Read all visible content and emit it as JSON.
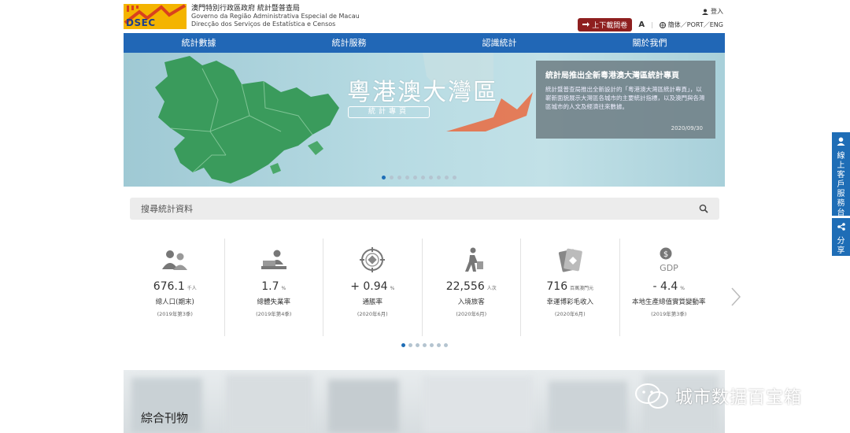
{
  "header": {
    "org_zh": "澳門特別行政區政府 統計暨普查局",
    "org_pt": "Governo da Região Administrativa Especial de Macau",
    "org_pt2": "Direcção dos Serviços de Estatística e Censos",
    "logo_text": "DSEC",
    "login": "登入",
    "download_button": "上下載問卷",
    "font_size": "A",
    "lang": "簡体／PORT／ENG"
  },
  "nav": {
    "items": [
      "統計數據",
      "統計服務",
      "認識統計",
      "關於我們"
    ]
  },
  "banner": {
    "title": "粵港澳大灣區",
    "subtitle": "統計專頁",
    "news_title": "統計局推出全新粵港澳大灣區統計專頁",
    "news_body": "統計暨普查局推出全新設計的「粵港澳大灣區統計專頁」，以嶄新面貌展示大灣區各城市的主要統計指標，以及澳門與各灣區城市的人文及經濟往來數據。",
    "news_date": "2020/09/30",
    "dots": 10,
    "active_dot": 0
  },
  "search": {
    "placeholder": "搜尋統計資料"
  },
  "stats": {
    "items": [
      {
        "value": "676.1",
        "unit": "千人",
        "label": "總人口(期末)",
        "period": "(2019年第3季)",
        "icon": "population-icon"
      },
      {
        "value": "1.7",
        "unit": "%",
        "label": "總體失業率",
        "period": "(2019年第4季)",
        "icon": "unemployment-icon"
      },
      {
        "value": "+ 0.94",
        "unit": "%",
        "label": "通脹率",
        "period": "(2020年6月)",
        "icon": "inflation-icon"
      },
      {
        "value": "22,556",
        "unit": "人次",
        "label": "入境旅客",
        "period": "(2020年6月)",
        "icon": "traveller-icon"
      },
      {
        "value": "716",
        "unit": "百萬澳門元",
        "label": "幸運博彩毛收入",
        "period": "(2020年6月)",
        "icon": "gaming-icon"
      },
      {
        "value": "- 4.4",
        "unit": "%",
        "label": "本地生產總值實質變動率",
        "period": "(2019年第3季)",
        "icon": "gdp-icon"
      }
    ],
    "dots": 7,
    "active_dot": 0,
    "gdp_icon_text": "GDP"
  },
  "publications": {
    "title": "綜合刊物"
  },
  "side": {
    "service_label": "線上客戶服務台",
    "share_label": "分享"
  },
  "watermark": {
    "text": "城市数据百宝箱"
  },
  "colors": {
    "nav_blue": "#2167b6",
    "accent_red": "#8e1f1f",
    "map_green": "#3a9b5c",
    "logo_yellow": "#f4b400"
  }
}
